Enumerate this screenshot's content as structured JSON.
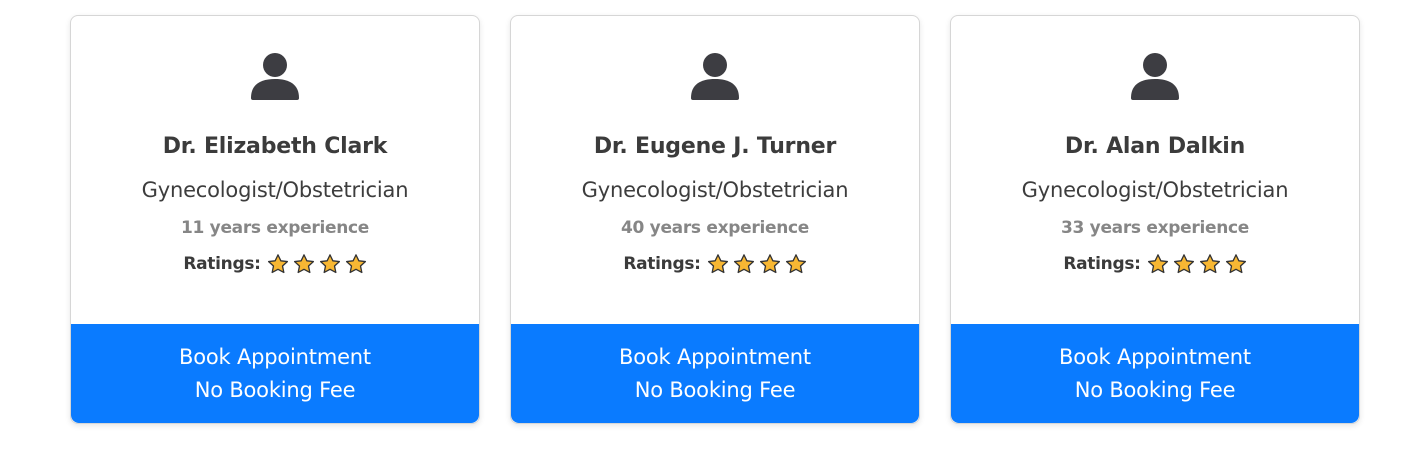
{
  "colors": {
    "button_bg": "#0a7bff",
    "button_text": "#ffffff",
    "star_fill": "#f7b733",
    "star_stroke": "#333333",
    "avatar_fill": "#3d3d42"
  },
  "doctors": [
    {
      "icon": "user-icon",
      "name": "Dr. Elizabeth Clark",
      "specialty": "Gynecologist/Obstetrician",
      "experience": "11 years experience",
      "ratings_label": "Ratings:",
      "rating_stars": 4,
      "book_line1": "Book Appointment",
      "book_line2": "No Booking Fee"
    },
    {
      "icon": "user-icon",
      "name": "Dr. Eugene J. Turner",
      "specialty": "Gynecologist/Obstetrician",
      "experience": "40 years experience",
      "ratings_label": "Ratings:",
      "rating_stars": 4,
      "book_line1": "Book Appointment",
      "book_line2": "No Booking Fee"
    },
    {
      "icon": "user-icon",
      "name": "Dr. Alan Dalkin",
      "specialty": "Gynecologist/Obstetrician",
      "experience": "33 years experience",
      "ratings_label": "Ratings:",
      "rating_stars": 4,
      "book_line1": "Book Appointment",
      "book_line2": "No Booking Fee"
    }
  ]
}
